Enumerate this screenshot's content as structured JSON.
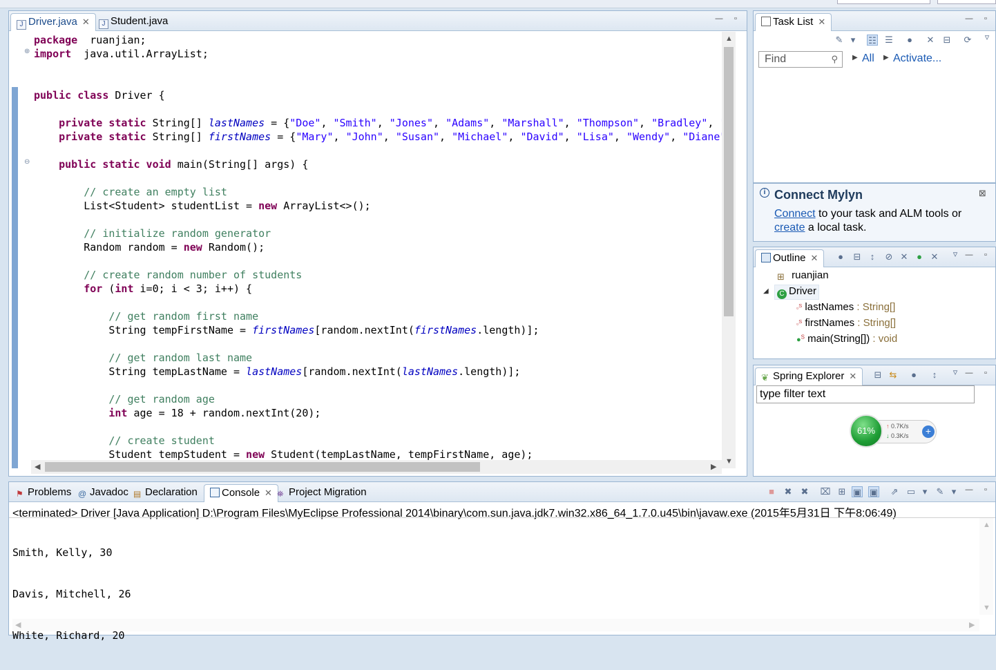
{
  "editor": {
    "tabs": [
      {
        "label": "Driver.java",
        "active": true
      },
      {
        "label": "Student.java",
        "active": false
      }
    ],
    "code_lines": [
      {
        "segments": [
          [
            "kw",
            "package"
          ],
          [
            "",
            "  ruanjian;"
          ]
        ]
      },
      {
        "segments": [
          [
            "kw",
            "import"
          ],
          [
            "",
            "  java.util.ArrayList;"
          ]
        ]
      },
      {
        "segments": []
      },
      {
        "segments": []
      },
      {
        "segments": [
          [
            "kw",
            "public class"
          ],
          [
            "",
            " Driver {"
          ]
        ]
      },
      {
        "segments": []
      },
      {
        "segments": [
          [
            "",
            "    "
          ],
          [
            "kw",
            "private static"
          ],
          [
            "",
            " String[] "
          ],
          [
            "fld",
            "lastNames"
          ],
          [
            "",
            " = {"
          ],
          [
            "str",
            "\"Doe\""
          ],
          [
            "",
            ", "
          ],
          [
            "str",
            "\"Smith\""
          ],
          [
            "",
            ", "
          ],
          [
            "str",
            "\"Jones\""
          ],
          [
            "",
            ", "
          ],
          [
            "str",
            "\"Adams\""
          ],
          [
            "",
            ", "
          ],
          [
            "str",
            "\"Marshall\""
          ],
          [
            "",
            ", "
          ],
          [
            "str",
            "\"Thompson\""
          ],
          [
            "",
            ", "
          ],
          [
            "str",
            "\"Bradley\""
          ],
          [
            "",
            ", "
          ],
          [
            "str",
            "\""
          ]
        ]
      },
      {
        "segments": [
          [
            "",
            "    "
          ],
          [
            "kw",
            "private static"
          ],
          [
            "",
            " String[] "
          ],
          [
            "fld",
            "firstNames"
          ],
          [
            "",
            " = {"
          ],
          [
            "str",
            "\"Mary\""
          ],
          [
            "",
            ", "
          ],
          [
            "str",
            "\"John\""
          ],
          [
            "",
            ", "
          ],
          [
            "str",
            "\"Susan\""
          ],
          [
            "",
            ", "
          ],
          [
            "str",
            "\"Michael\""
          ],
          [
            "",
            ", "
          ],
          [
            "str",
            "\"David\""
          ],
          [
            "",
            ", "
          ],
          [
            "str",
            "\"Lisa\""
          ],
          [
            "",
            ", "
          ],
          [
            "str",
            "\"Wendy\""
          ],
          [
            "",
            ", "
          ],
          [
            "str",
            "\"Diane\""
          ]
        ]
      },
      {
        "segments": []
      },
      {
        "segments": [
          [
            "",
            "    "
          ],
          [
            "kw",
            "public static void"
          ],
          [
            "",
            " main(String[] args) {"
          ]
        ]
      },
      {
        "segments": []
      },
      {
        "segments": [
          [
            "",
            "        "
          ],
          [
            "cm",
            "// create an empty list"
          ]
        ]
      },
      {
        "segments": [
          [
            "",
            "        List<Student> studentList = "
          ],
          [
            "kw",
            "new"
          ],
          [
            "",
            " ArrayList<>();"
          ]
        ]
      },
      {
        "segments": []
      },
      {
        "segments": [
          [
            "",
            "        "
          ],
          [
            "cm",
            "// initialize random generator"
          ]
        ]
      },
      {
        "segments": [
          [
            "",
            "        Random random = "
          ],
          [
            "kw",
            "new"
          ],
          [
            "",
            " Random();"
          ]
        ]
      },
      {
        "segments": []
      },
      {
        "segments": [
          [
            "",
            "        "
          ],
          [
            "cm",
            "// create random number of students"
          ]
        ]
      },
      {
        "segments": [
          [
            "",
            "        "
          ],
          [
            "kw",
            "for"
          ],
          [
            "",
            " ("
          ],
          [
            "kw",
            "int"
          ],
          [
            "",
            " i=0; i < 3; i++) {"
          ]
        ]
      },
      {
        "segments": []
      },
      {
        "segments": [
          [
            "",
            "            "
          ],
          [
            "cm",
            "// get random first name"
          ]
        ]
      },
      {
        "segments": [
          [
            "",
            "            String tempFirstName = "
          ],
          [
            "fld",
            "firstNames"
          ],
          [
            "",
            "[random.nextInt("
          ],
          [
            "fld",
            "firstNames"
          ],
          [
            "",
            ".length)];"
          ]
        ]
      },
      {
        "segments": []
      },
      {
        "segments": [
          [
            "",
            "            "
          ],
          [
            "cm",
            "// get random last name"
          ]
        ]
      },
      {
        "segments": [
          [
            "",
            "            String tempLastName = "
          ],
          [
            "fld",
            "lastNames"
          ],
          [
            "",
            "[random.nextInt("
          ],
          [
            "fld",
            "lastNames"
          ],
          [
            "",
            ".length)];"
          ]
        ]
      },
      {
        "segments": []
      },
      {
        "segments": [
          [
            "",
            "            "
          ],
          [
            "cm",
            "// get random age"
          ]
        ]
      },
      {
        "segments": [
          [
            "",
            "            "
          ],
          [
            "kw",
            "int"
          ],
          [
            "",
            " age = 18 + random.nextInt(20);"
          ]
        ]
      },
      {
        "segments": []
      },
      {
        "segments": [
          [
            "",
            "            "
          ],
          [
            "cm",
            "// create student"
          ]
        ]
      },
      {
        "segments": [
          [
            "",
            "            Student tempStudent = "
          ],
          [
            "kw",
            "new"
          ],
          [
            "",
            " Student(tempLastName, tempFirstName, age);"
          ]
        ]
      }
    ]
  },
  "tasklist": {
    "tab_label": "Task List",
    "find_placeholder": "Find",
    "all_label": "All",
    "activate_label": "Activate..."
  },
  "mylyn": {
    "title": "Connect Mylyn",
    "connect_link": "Connect",
    "line1_rest": " to your task and ALM tools or",
    "create_link": "create",
    "line2_rest": " a local task."
  },
  "outline": {
    "tab_label": "Outline",
    "package": "ruanjian",
    "class": "Driver",
    "members": [
      {
        "name": "lastNames",
        "type": " : String[]"
      },
      {
        "name": "firstNames",
        "type": " : String[]"
      },
      {
        "name": "main(String[])",
        "type": " : void"
      }
    ]
  },
  "spring": {
    "tab_label": "Spring Explorer",
    "filter_placeholder": "type filter text"
  },
  "netmeter": {
    "percent": "61%",
    "up": "0.7K/s",
    "down": "0.3K/s"
  },
  "console": {
    "tabs": [
      "Problems",
      "Javadoc",
      "Declaration",
      "Console",
      "Project Migration"
    ],
    "terminated": "<terminated> Driver [Java Application] D:\\Program Files\\MyEclipse Professional 2014\\binary\\com.sun.java.jdk7.win32.x86_64_1.7.0.u45\\bin\\javaw.exe (2015年5月31日 下午8:06:49)",
    "output": [
      "Smith, Kelly, 30",
      "Davis, Mitchell, 26",
      "White, Richard, 20"
    ]
  },
  "colors": {
    "keyword": "#7f0055",
    "string": "#2a00ff",
    "field": "#0000c0",
    "comment": "#3f7f5f",
    "link": "#1a5ab4"
  }
}
